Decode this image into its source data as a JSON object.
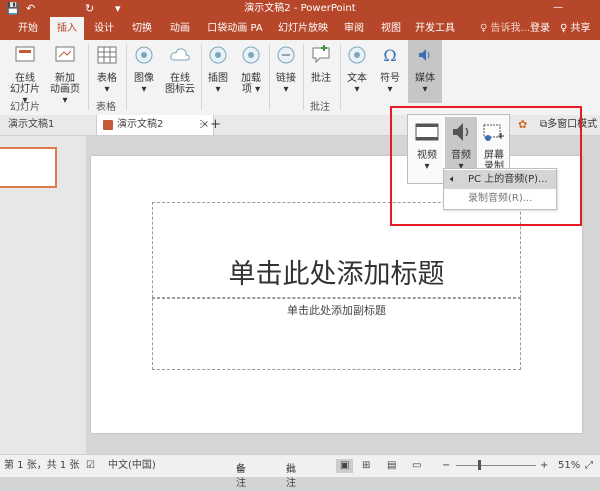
{
  "titlebar": {
    "doc_title": "演示文稿2 - PowerPoint",
    "qa_save": "💾",
    "qa_undo": "↶",
    "qa_redo": "↻",
    "qa_custom": "▾",
    "min": "—"
  },
  "tabs": [
    {
      "label": "开始"
    },
    {
      "label": "插入"
    },
    {
      "label": "设计"
    },
    {
      "label": "切换"
    },
    {
      "label": "动画"
    },
    {
      "label": "口袋动画 PA"
    },
    {
      "label": "幻灯片放映"
    },
    {
      "label": "审阅"
    },
    {
      "label": "视图"
    },
    {
      "label": "开发工具"
    }
  ],
  "tell_me": "♀ 告诉我...",
  "login": "登录",
  "share": "♀ 共享",
  "ribbon": {
    "new_slide_l1": "在线",
    "new_slide_l2": "幻灯片 ▾",
    "anim_l1": "新加",
    "anim_l2": "动画页 ▾",
    "table_l1": "表格",
    "table_l2": "▾",
    "image_l1": "图像",
    "image_l2": "▾",
    "online_l1": "在线",
    "online_l2": "图标云",
    "illus_l1": "插图",
    "illus_l2": "▾",
    "addin_l1": "加载",
    "addin_l2": "项 ▾",
    "link_l1": "链接",
    "link_l2": "▾",
    "comment_l1": "批注",
    "text_l1": "文本",
    "text_l2": "▾",
    "symbol_l1": "符号",
    "symbol_l2": "▾",
    "media_l1": "媒体",
    "media_l2": "▾",
    "grp_slides": "幻灯片",
    "grp_table": "表格",
    "grp_comments": "批注"
  },
  "doctabs": {
    "tab1": "演示文稿1",
    "tab2": "演示文稿2",
    "close": "×",
    "more": "⋮",
    "add": "+",
    "multiwin": "多窗口模式"
  },
  "media_menu": {
    "video_l1": "视频",
    "video_l2": "▾",
    "audio_l1": "音频",
    "audio_l2": "▾",
    "screen_l1": "屏幕",
    "screen_l2": "录制"
  },
  "audio_submenu": {
    "item1": "PC 上的音频(P)...",
    "item2": "录制音频(R)..."
  },
  "slide": {
    "title_placeholder": "单击此处添加标题",
    "subtitle_placeholder": "单击此处添加副标题"
  },
  "status": {
    "slide_info": "第 1 张，共 1 张",
    "language": "中文(中国)",
    "notes": "备注",
    "comments": "批注",
    "minus": "−",
    "plus": "+",
    "zoom": "51%"
  },
  "colors": {
    "accent": "#b7472a",
    "highlight_border": "#e51c23"
  }
}
